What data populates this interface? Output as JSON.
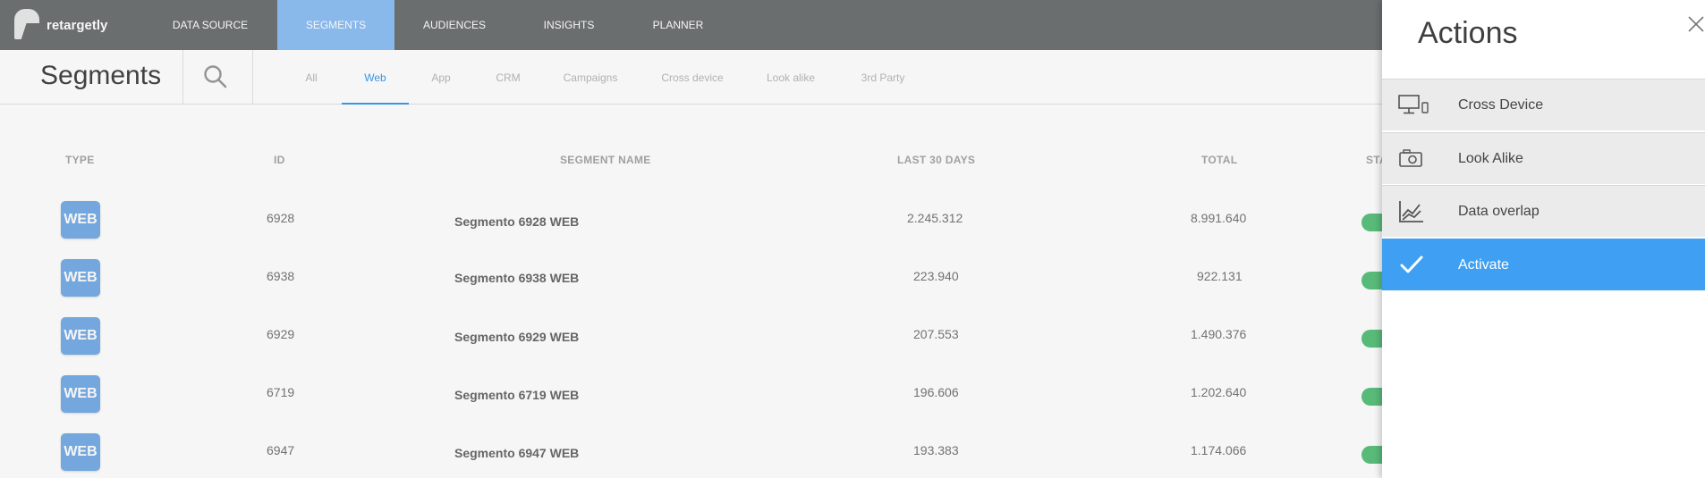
{
  "app": {
    "logo_text": "retargetly"
  },
  "nav": {
    "items": [
      {
        "label": "DATA SOURCE",
        "active": false
      },
      {
        "label": "SEGMENTS",
        "active": true
      },
      {
        "label": "AUDIENCES",
        "active": false
      },
      {
        "label": "INSIGHTS",
        "active": false
      },
      {
        "label": "PLANNER",
        "active": false
      }
    ]
  },
  "page": {
    "title": "Segments"
  },
  "tabs": [
    {
      "label": "All",
      "active": false
    },
    {
      "label": "Web",
      "active": true
    },
    {
      "label": "App",
      "active": false
    },
    {
      "label": "CRM",
      "active": false
    },
    {
      "label": "Campaigns",
      "active": false
    },
    {
      "label": "Cross device",
      "active": false
    },
    {
      "label": "Look alike",
      "active": false
    },
    {
      "label": "3rd Party",
      "active": false
    }
  ],
  "table": {
    "headers": {
      "type": "TYPE",
      "id": "ID",
      "name": "SEGMENT NAME",
      "last30": "LAST 30 DAYS",
      "total": "TOTAL",
      "status": "STA"
    },
    "rows": [
      {
        "type": "WEB",
        "id": "6928",
        "name": "Segmento 6928 WEB",
        "last30": "2.245.312",
        "total": "8.991.640"
      },
      {
        "type": "WEB",
        "id": "6938",
        "name": "Segmento 6938 WEB",
        "last30": "223.940",
        "total": "922.131"
      },
      {
        "type": "WEB",
        "id": "6929",
        "name": "Segmento 6929 WEB",
        "last30": "207.553",
        "total": "1.490.376"
      },
      {
        "type": "WEB",
        "id": "6719",
        "name": "Segmento 6719 WEB",
        "last30": "196.606",
        "total": "1.202.640"
      },
      {
        "type": "WEB",
        "id": "6947",
        "name": "Segmento 6947 WEB",
        "last30": "193.383",
        "total": "1.174.066"
      }
    ]
  },
  "panel": {
    "title": "Actions",
    "actions": [
      {
        "label": "Cross Device",
        "icon": "devices-icon",
        "active": false
      },
      {
        "label": "Look Alike",
        "icon": "camera-icon",
        "active": false
      },
      {
        "label": "Data overlap",
        "icon": "line-chart-icon",
        "active": false
      },
      {
        "label": "Activate",
        "icon": "check-icon",
        "active": true
      }
    ]
  },
  "colors": {
    "nav_bg": "#6e7374",
    "nav_active": "#8ebff4",
    "tab_active": "#3d9be9",
    "badge": "#79aee6",
    "status_toggle": "#5cc17e",
    "action_active": "#3f9ff2"
  }
}
